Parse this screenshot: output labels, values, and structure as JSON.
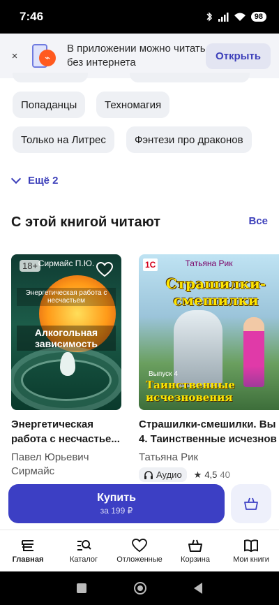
{
  "status": {
    "time": "7:46",
    "battery": "98"
  },
  "banner": {
    "close_icon": "×",
    "text": "В приложении можно читать без интернета",
    "open_label": "Открыть"
  },
  "tags": [
    "Попаданцы",
    "Техномагия",
    "Только на Литрес",
    "Фэнтези про драконов"
  ],
  "more_label": "Ещё 2",
  "section": {
    "title": "С этой книгой читают",
    "all_label": "Все"
  },
  "books": [
    {
      "cover_author": "Сирмайс П.Ю.",
      "cover_line1": "Энергетическая работа с несчастьем",
      "cover_line2": "Алкогольная зависимость",
      "age": "18+",
      "title_line1": "Энергетическая",
      "title_line2": "работа с несчастье...",
      "author_line1": "Павел Юрьевич",
      "author_line2": "Сирмайс"
    },
    {
      "cover_logo": "1С",
      "cover_author": "Татьяна Рик",
      "cover_title": "Страшилки-смешилки",
      "cover_issue": "Выпуск 4",
      "cover_sub": "Таинственные исчезновения",
      "title_line1": "Страшилки-смешилки. Вы",
      "title_line2": "4. Таинственные исчезнов",
      "author_line1": "Татьяна Рик",
      "audio_label": "Аудио",
      "rating": "4,5",
      "rating_count": "40"
    }
  ],
  "buy": {
    "label": "Купить",
    "price": "за 199 ₽"
  },
  "tabs": [
    {
      "label": "Главная",
      "icon": "home-icon"
    },
    {
      "label": "Каталог",
      "icon": "catalog-search-icon"
    },
    {
      "label": "Отложенные",
      "icon": "heart-icon"
    },
    {
      "label": "Корзина",
      "icon": "basket-icon"
    },
    {
      "label": "Мои книги",
      "icon": "open-book-icon"
    }
  ],
  "colors": {
    "accent": "#3c3fc4",
    "chip_bg": "#eef0f4",
    "banner_bg": "#f3f4f8"
  }
}
